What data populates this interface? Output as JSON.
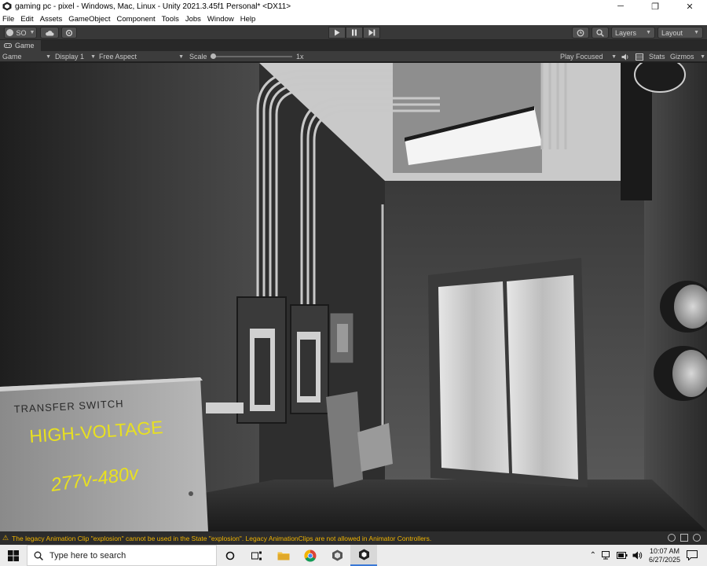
{
  "window": {
    "title": "gaming pc - pixel - Windows, Mac, Linux - Unity 2021.3.45f1 Personal* <DX11>",
    "minimize_glyph": "─",
    "restore_glyph": "❐",
    "close_glyph": "✕"
  },
  "menu": [
    "File",
    "Edit",
    "Assets",
    "GameObject",
    "Component",
    "Tools",
    "Jobs",
    "Window",
    "Help"
  ],
  "toolbar": {
    "account_label": "SO",
    "layers_label": "Layers",
    "layout_label": "Layout"
  },
  "tab": {
    "label": "Game"
  },
  "gamebar": {
    "mode": "Game",
    "display": "Display 1",
    "aspect": "Free Aspect",
    "scale_label": "Scale",
    "scale_value": "1x",
    "play_mode": "Play Focused",
    "stats": "Stats",
    "gizmos": "Gizmos"
  },
  "scene": {
    "sign_line1": "TRANSFER SWITCH",
    "sign_line2": "HIGH-VOLTAGE",
    "sign_line3": "277v-480v"
  },
  "status": {
    "message": "The legacy Animation Clip \"explosion\" cannot be used in the State \"explosion\". Legacy AnimationClips are not allowed in Animator Controllers."
  },
  "taskbar": {
    "search_placeholder": "Type here to search",
    "time": "10:07 AM",
    "date": "6/27/2025"
  },
  "colors": {
    "warning": "#f0b400",
    "sign_text": "#e8e020"
  }
}
